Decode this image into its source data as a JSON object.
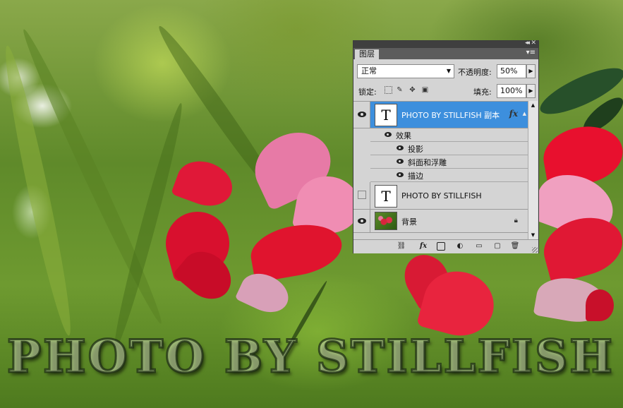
{
  "panel": {
    "tab_label": "图层",
    "blend_mode": "正常",
    "opacity_label": "不透明度:",
    "opacity_value": "50%",
    "lock_label": "锁定:",
    "fill_label": "填充:",
    "fill_value": "100%"
  },
  "layers": [
    {
      "name": "PHOTO BY STILLFISH 副本",
      "thumb_glyph": "T",
      "fx": "fx",
      "visible": true,
      "selected": true,
      "effects_label": "效果",
      "effects": [
        "投影",
        "斜面和浮雕",
        "描边"
      ]
    },
    {
      "name": "PHOTO BY STILLFISH",
      "thumb_glyph": "T",
      "visible": false,
      "selected": false
    },
    {
      "name": "背景",
      "visible": true,
      "selected": false,
      "locked": true
    }
  ],
  "bottom_bar": {
    "fx_label": "fx"
  },
  "watermark_text": "PHOTO BY STILLFISH",
  "colors": {
    "selection": "#3d8fdd",
    "panel_bg": "#d4d4d4",
    "titlebar": "#3f3f3f"
  },
  "icons": {
    "collapse": "double-chevron-icon",
    "close": "close-icon",
    "panel_menu": "panel-menu-icon",
    "lock_transparent": "lock-transparent-pixels-icon",
    "lock_image": "lock-image-pixels-icon",
    "lock_position": "lock-position-icon",
    "lock_all": "lock-all-icon",
    "link": "link-layers-icon",
    "mask": "layer-mask-icon",
    "adjustment": "adjustment-layer-icon",
    "group": "new-group-icon",
    "new_layer": "new-layer-icon",
    "delete": "trash-icon"
  }
}
